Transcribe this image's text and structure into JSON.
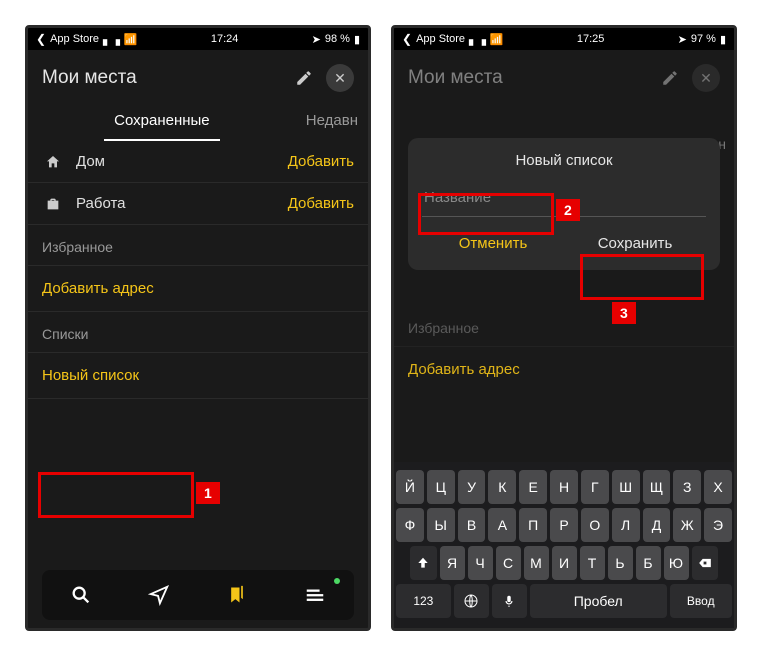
{
  "left": {
    "status": {
      "back": "App Store",
      "time": "17:24",
      "battery": "98 %"
    },
    "header": {
      "title": "Мои места"
    },
    "tabs": {
      "active": "Сохраненные",
      "partial": "Недавн"
    },
    "home": {
      "label": "Дом",
      "action": "Добавить"
    },
    "work": {
      "label": "Работа",
      "action": "Добавить"
    },
    "fav": "Избранное",
    "addaddr": "Добавить адрес",
    "lists": "Списки",
    "newlist": "Новый список",
    "anno1": "1"
  },
  "right": {
    "status": {
      "back": "App Store",
      "time": "17:25",
      "battery": "97 %"
    },
    "header": {
      "title": "Мои места"
    },
    "tab_partial": "авн",
    "dialog": {
      "title": "Новый список",
      "placeholder": "Название",
      "cancel": "Отменить",
      "save": "Сохранить"
    },
    "fav": "Избранное",
    "addaddr": "Добавить адрес",
    "anno2": "2",
    "anno3": "3",
    "kb": {
      "r1": [
        "Й",
        "Ц",
        "У",
        "К",
        "Е",
        "Н",
        "Г",
        "Ш",
        "Щ",
        "З",
        "Х"
      ],
      "r2": [
        "Ф",
        "Ы",
        "В",
        "А",
        "П",
        "Р",
        "О",
        "Л",
        "Д",
        "Ж",
        "Э"
      ],
      "r3": [
        "Я",
        "Ч",
        "С",
        "М",
        "И",
        "Т",
        "Ь",
        "Б",
        "Ю"
      ],
      "num": "123",
      "space": "Пробел",
      "enter": "Ввод"
    }
  }
}
